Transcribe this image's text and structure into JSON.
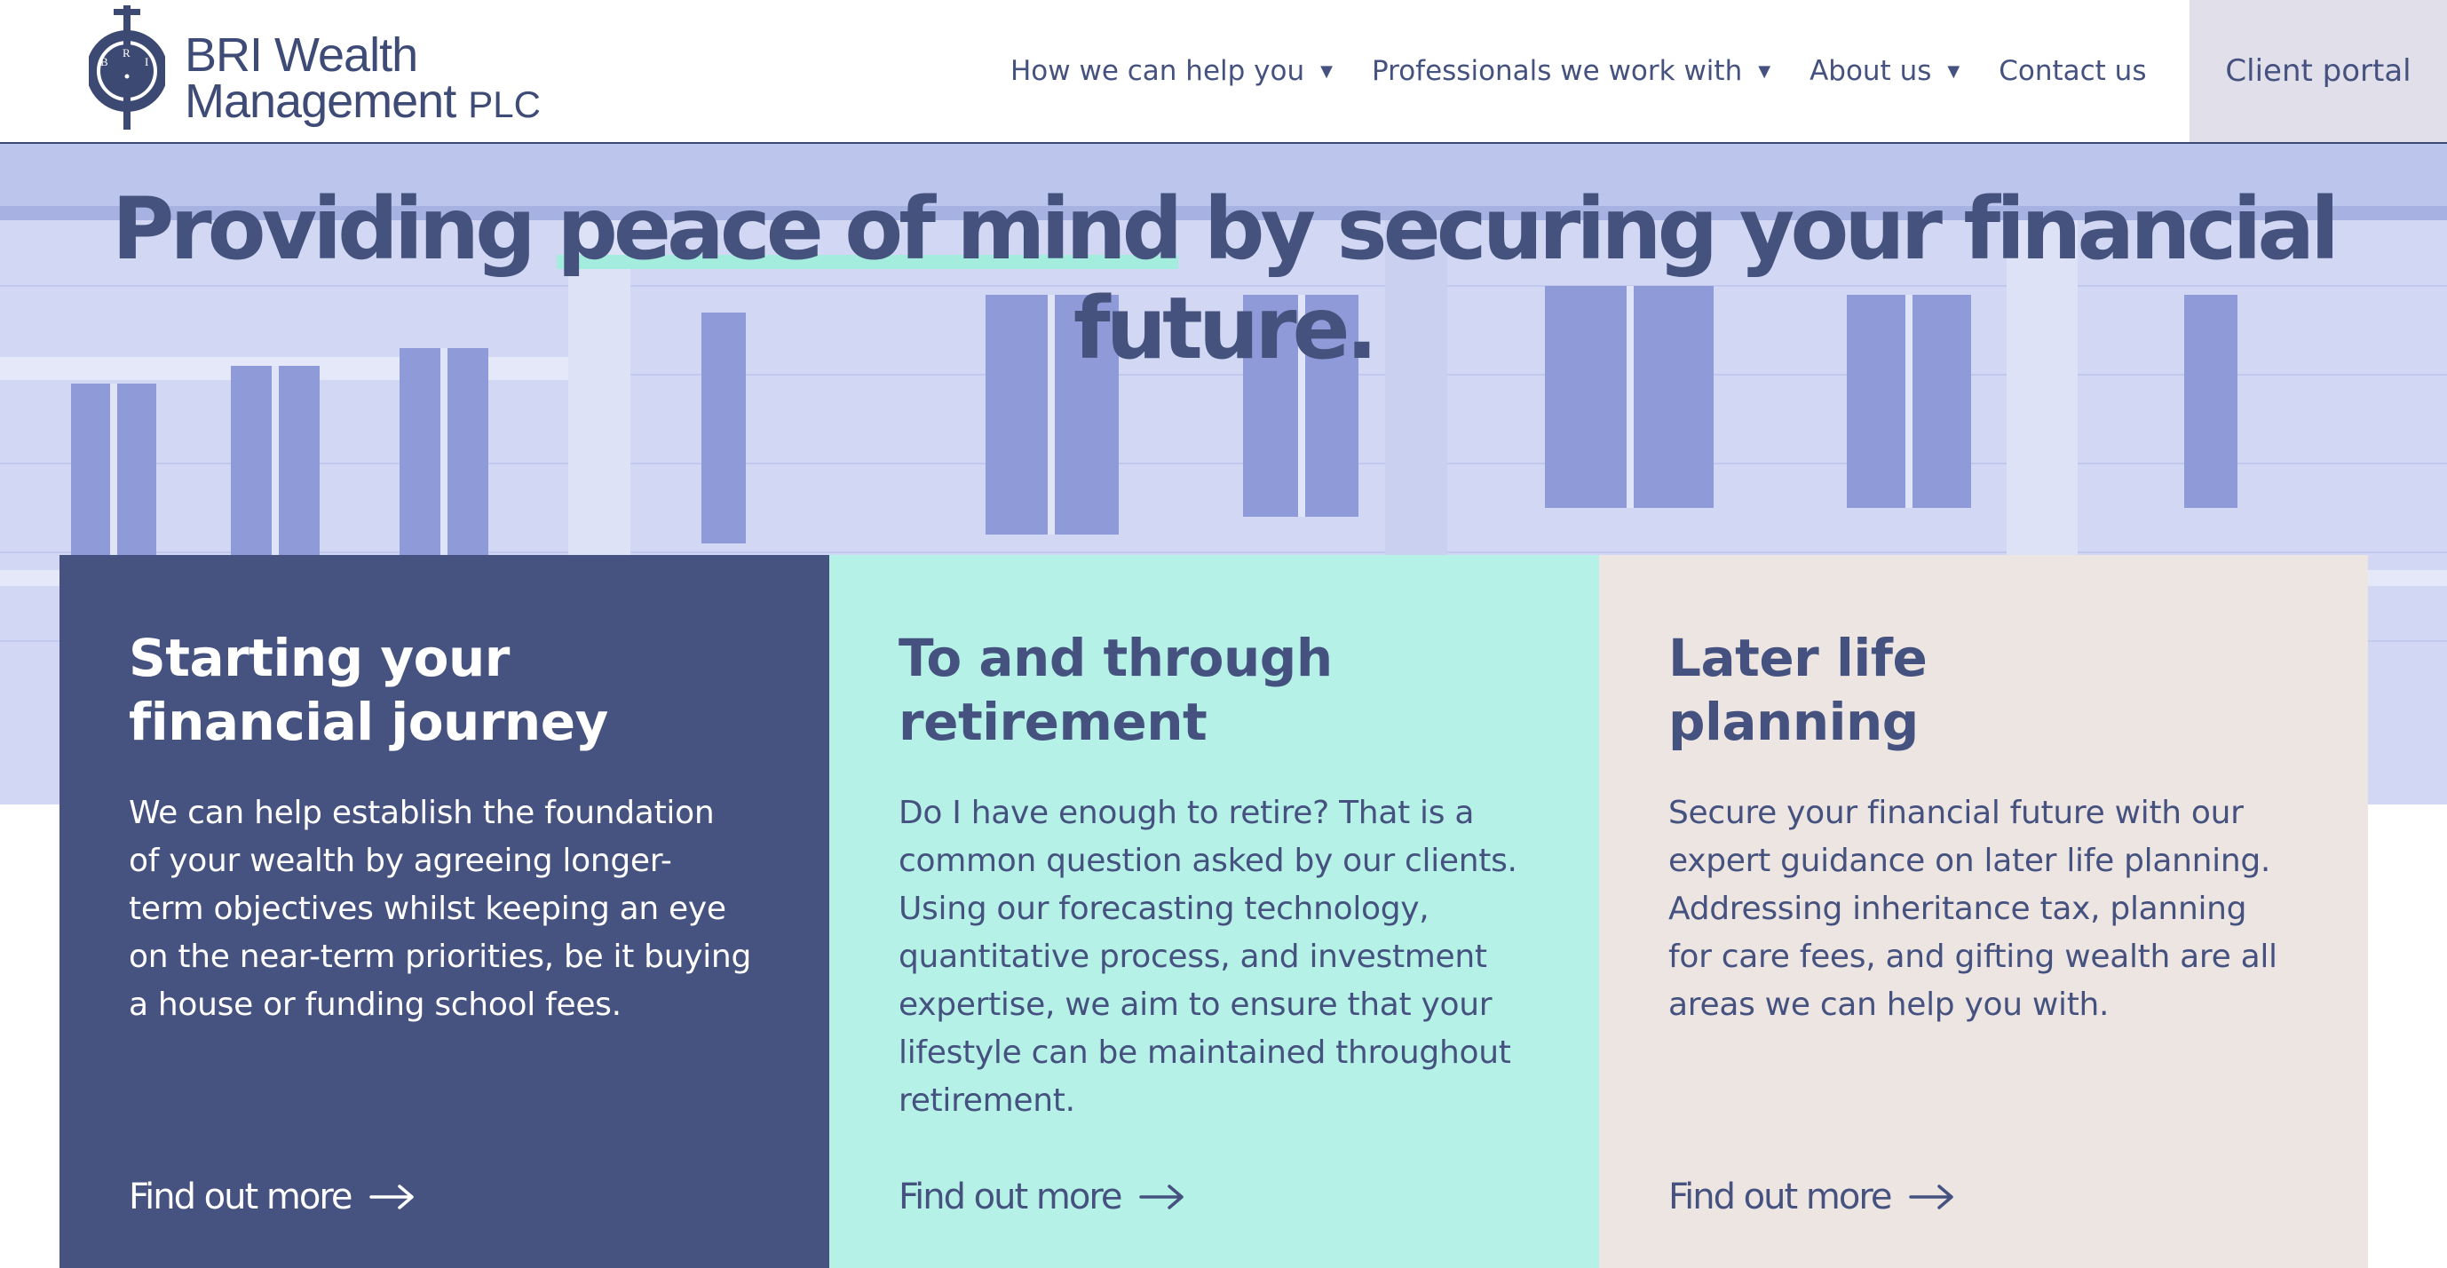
{
  "header": {
    "logo": {
      "line1": "BRI Wealth",
      "line2": "Management",
      "suffix": "PLC",
      "mark_letters": [
        "B",
        "R",
        "I"
      ]
    },
    "nav": [
      {
        "label": "How we can help you",
        "has_dropdown": true
      },
      {
        "label": "Professionals we work with",
        "has_dropdown": true
      },
      {
        "label": "About us",
        "has_dropdown": true
      },
      {
        "label": "Contact us",
        "has_dropdown": false
      }
    ],
    "caret_glyph": "▼",
    "client_portal": "Client portal"
  },
  "hero": {
    "title_before": "Providing ",
    "title_highlight": "peace of mind",
    "title_after": " by securing your financial",
    "title_line2": "future.",
    "highlight_color": "#a4ecdd"
  },
  "cards": [
    {
      "title_line1": "Starting your",
      "title_line2": "financial journey",
      "body": "We can help establish the foundation\nof your wealth by agreeing longer-\nterm objectives whilst keeping an eye\non the near-term priorities, be it buying\na house or funding school fees.",
      "link": "Find out more",
      "bg": "#46527f"
    },
    {
      "title_line1": "To and through",
      "title_line2": "retirement",
      "body": "Do I have enough to retire? That is a\ncommon question asked by our clients.\nUsing our forecasting technology,\nquantitative process, and investment\nexpertise, we aim to ensure that your\nlifestyle can be maintained throughout\nretirement.",
      "link": "Find out more",
      "bg": "#b5f1e6"
    },
    {
      "title_line1": "Later life",
      "title_line2": "planning",
      "body": "Secure your financial future with our\nexpert guidance on later life planning.\nAddressing inheritance tax, planning\nfor care fees, and gifting wealth are all\nareas we can help you with.",
      "link": "Find out more",
      "bg": "#ede5e2"
    }
  ],
  "colors": {
    "brand_navy": "#46527f",
    "mint": "#b5f1e6",
    "sand": "#ede5e2",
    "portal_bg": "#e1e0ea"
  },
  "icons": [
    "logo-crest-icon",
    "caret-down-icon",
    "arrow-right-icon"
  ]
}
